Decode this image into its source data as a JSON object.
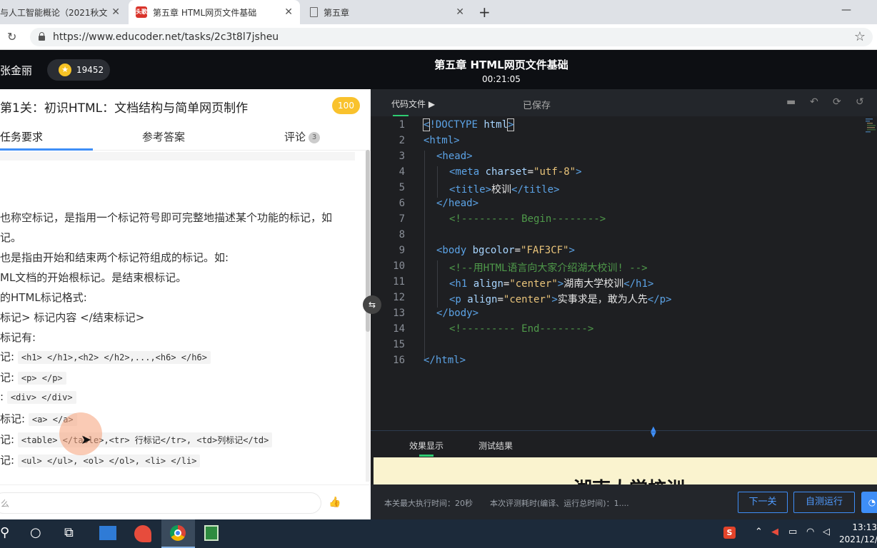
{
  "browser": {
    "tabs": [
      {
        "title": "与人工智能概论（2021秋文"
      },
      {
        "title": "第五章 HTML网页文件基础",
        "favicon_text": "头歌"
      },
      {
        "title": "第五章"
      }
    ],
    "url": "https://www.educoder.net/tasks/2c3t8l7jsheu"
  },
  "header": {
    "username": "张金丽",
    "coins": "19452",
    "title": "第五章 HTML网页文件基础",
    "timer": "00:21:05"
  },
  "task": {
    "title": "第1关：初识HTML：文档结构与简单网页制作",
    "score": "100",
    "tabs": {
      "requirements": "任务要求",
      "answer": "参考答案",
      "comments": "评论",
      "comments_count": "3"
    },
    "lines": [
      "也称空标记，是指用一个标记符号即可完整地描述某个功能的标记，如",
      "记。",
      "也是指由开始和结束两个标记符组成的标记。如:",
      "ML文档的开始根标记。是结束根标记。",
      "的HTML标记格式:",
      "标记> 标记内容 </结束标记>",
      "标记有:"
    ],
    "code_rows": [
      {
        "label": "记:",
        "code": "<h1> </h1>,<h2> </h2>,...,<h6> </h6>"
      },
      {
        "label": "记:",
        "code": "<p> </p>"
      },
      {
        "label": ":",
        "code": "<div> </div>"
      },
      {
        "label": "标记:",
        "code": "<a> </a>"
      },
      {
        "label": "记:",
        "code": "<table> </table>,<tr> 行标记</tr>, <td>列标记</td>"
      },
      {
        "label": "记:",
        "code": "<ul> </ul>, <ol> </ol>, <li> </li>"
      }
    ],
    "comment_placeholder": "么"
  },
  "editor": {
    "file_tab": "代码文件",
    "saved_status": "已保存",
    "line_numbers": [
      "1",
      "2",
      "3",
      "4",
      "5",
      "6",
      "7",
      "8",
      "9",
      "10",
      "11",
      "12",
      "13",
      "14",
      "15",
      "16"
    ],
    "code": {
      "l1": {
        "open": "<",
        "doctype": "!DOCTYPE",
        "html": "html",
        "close": ">"
      },
      "l2": "<html>",
      "l3": "<head>",
      "l4": {
        "tag_open": "<meta",
        "attr": "charset",
        "eq": "=",
        "val": "\"utf-8\"",
        "end": ">"
      },
      "l5": {
        "open": "<title>",
        "text": "校训",
        "close": "</title>"
      },
      "l6": "</head>",
      "l7": "<!--------- Begin-------->",
      "l9": {
        "tag_open": "<body",
        "attr": "bgcolor",
        "eq": "=",
        "val": "\"FAF3CF\"",
        "end": ">"
      },
      "l10": "<!--用HTML语言向大家介绍湖大校训! -->",
      "l11": {
        "tag_open": "<h1",
        "attr": "align",
        "eq": "=",
        "val": "\"center\"",
        "end": ">",
        "text": "湖南大学校训",
        "close": "</h1>"
      },
      "l12": {
        "tag_open": "<p",
        "attr": "align",
        "eq": "=",
        "val": "\"center\"",
        "end": ">",
        "text": "实事求是，敢为人先",
        "close": "</p>"
      },
      "l13": "</body>",
      "l14": "<!--------- End-------->",
      "l16": "</html>"
    }
  },
  "result": {
    "tab_preview": "效果显示",
    "tab_test": "测试结果",
    "preview_heading": "湖南大学校训",
    "max_time": "本关最大执行时间：20秒",
    "eval_time": "本次评测耗时(编译、运行总时间)：1....",
    "next_button": "下一关",
    "run_button": "自测运行"
  },
  "taskbar": {
    "time": "13:13",
    "date": "2021/12/"
  },
  "colors": {
    "accent": "#3e8ef7",
    "badge": "#f9c22d",
    "preview_bg": "#faf3cf"
  }
}
